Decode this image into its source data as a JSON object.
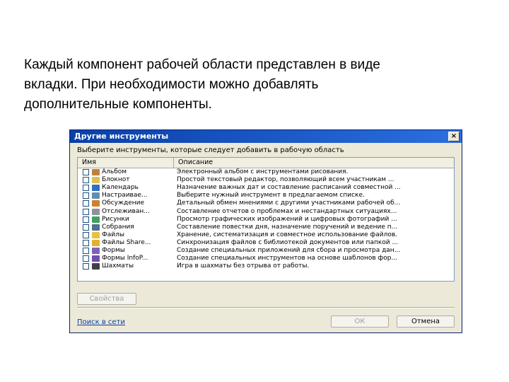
{
  "intro": {
    "line1": "Каждый компонент рабочей области представлен в виде",
    "line2": "вкладки. При необходимости можно добавлять",
    "line3": "дополнительные компоненты."
  },
  "dialog": {
    "title": "Другие инструменты",
    "close_glyph": "×",
    "prompt": "Выберите инструменты, которые следует добавить в рабочую область",
    "columns": {
      "name": "Имя",
      "description": "Описание"
    },
    "tools": [
      {
        "name": "Альбом",
        "description": "Электронный альбом с инструментами рисования.",
        "icon": "album-icon",
        "color": "#c08040"
      },
      {
        "name": "Блокнот",
        "description": "Простой текстовый редактор, позволяющий всем участникам ...",
        "icon": "notepad-icon",
        "color": "#e0c050"
      },
      {
        "name": "Календарь",
        "description": "Назначение важных дат и составление расписаний совместной ...",
        "icon": "calendar-icon",
        "color": "#3070c0"
      },
      {
        "name": "Настраивае...",
        "description": "Выберите нужный инструмент в предлагаемом списке.",
        "icon": "custom-tool-icon",
        "color": "#6090b0"
      },
      {
        "name": "Обсуждение",
        "description": "Детальный обмен мнениями с другими участниками рабочей об...",
        "icon": "discussion-icon",
        "color": "#d08030"
      },
      {
        "name": "Отслеживан...",
        "description": "Составление отчетов о проблемах и нестандартных ситуациях...",
        "icon": "tracking-icon",
        "color": "#9090a0"
      },
      {
        "name": "Рисунки",
        "description": "Просмотр графических изображений и цифровых фотографий ...",
        "icon": "pictures-icon",
        "color": "#40a060"
      },
      {
        "name": "Собрания",
        "description": "Составление повестки дня, назначение поручений и ведение п...",
        "icon": "meetings-icon",
        "color": "#507090"
      },
      {
        "name": "Файлы",
        "description": "Хранение, систематизация и совместное использование файлов.",
        "icon": "folder-icon",
        "color": "#e8c040"
      },
      {
        "name": "Файлы Share...",
        "description": "Синхронизация файлов с библиотекой документов или папкой ...",
        "icon": "sharepoint-files-icon",
        "color": "#e0b030"
      },
      {
        "name": "Формы",
        "description": "Создание специальных приложений для сбора и просмотра дан...",
        "icon": "forms-icon",
        "color": "#8060c0"
      },
      {
        "name": "Формы InfoP...",
        "description": "Создание специальных инструментов на основе шаблонов фор...",
        "icon": "infopath-forms-icon",
        "color": "#7050b0"
      },
      {
        "name": "Шахматы",
        "description": "Игра в шахматы без отрыва от работы.",
        "icon": "chess-icon",
        "color": "#404040"
      }
    ],
    "properties_button": "Свойства",
    "search_link": "Поиск в сети",
    "ok_button": "ОК",
    "cancel_button": "Отмена"
  }
}
